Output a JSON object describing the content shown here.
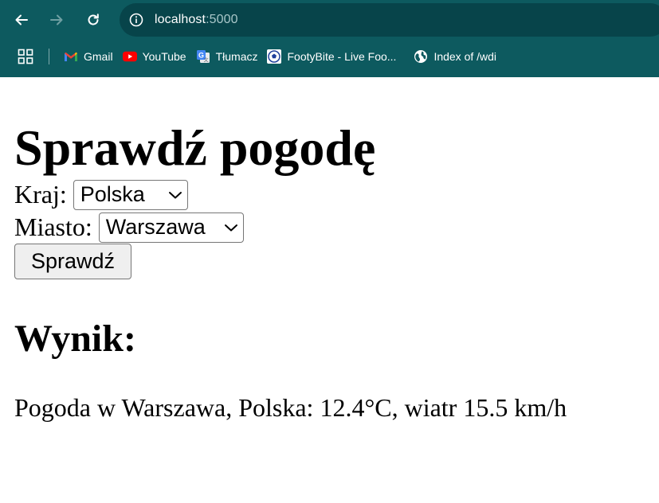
{
  "browser": {
    "url_host": "localhost",
    "url_port": ":5000",
    "icons": {
      "back": "arrow-left-icon",
      "forward": "arrow-right-icon",
      "reload": "reload-icon",
      "info": "info-icon",
      "apps": "apps-grid-icon"
    },
    "bookmarks": [
      {
        "label": "Gmail",
        "icon": "gmail-icon"
      },
      {
        "label": "YouTube",
        "icon": "youtube-icon"
      },
      {
        "label": "Tłumacz",
        "icon": "translate-icon"
      },
      {
        "label": "FootyBite - Live Foo...",
        "icon": "footybite-icon"
      },
      {
        "label": "Index of /wdi",
        "icon": "globe-icon"
      }
    ],
    "colors": {
      "chrome_bg": "#0d5a5f",
      "omnibox_bg": "#07444a"
    }
  },
  "page": {
    "title": "Sprawdź pogodę",
    "form": {
      "country_label": "Kraj:",
      "country_value": "Polska",
      "city_label": "Miasto:",
      "city_value": "Warszawa",
      "submit_label": "Sprawdź"
    },
    "result_heading": "Wynik:",
    "result_text": "Pogoda w Warszawa, Polska: 12.4°C, wiatr 15.5 km/h"
  }
}
